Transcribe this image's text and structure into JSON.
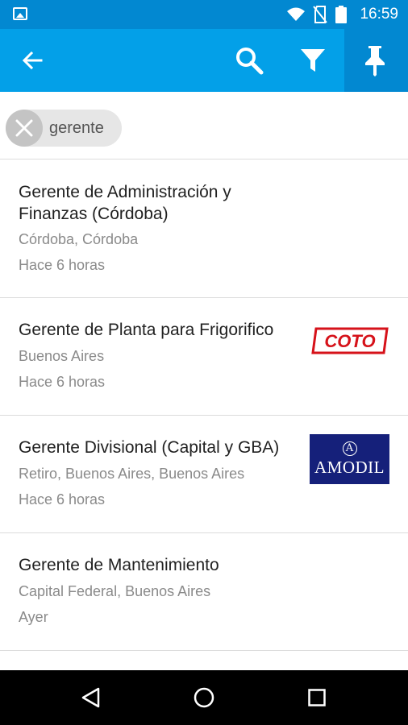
{
  "status_bar": {
    "time": "16:59",
    "icons": [
      "image-icon",
      "wifi-icon",
      "no-sim-icon",
      "battery-icon"
    ]
  },
  "app_bar": {
    "icons": [
      "back-arrow-icon",
      "search-icon",
      "filter-icon",
      "pin-icon"
    ],
    "colors": {
      "primary": "#03a0e8",
      "primary_dark": "#0288d1"
    }
  },
  "filter_chip": {
    "label": "gerente"
  },
  "jobs": [
    {
      "title": "Gerente de Administración y Finanzas (Córdoba)",
      "location": "Córdoba, Córdoba",
      "posted": "Hace 6 horas",
      "logo": ""
    },
    {
      "title": "Gerente de Planta para Frigorifico",
      "location": "Buenos Aires",
      "posted": "Hace 6 horas",
      "logo": "COTO"
    },
    {
      "title": "Gerente Divisional (Capital y GBA)",
      "location": "Retiro, Buenos Aires, Buenos Aires",
      "posted": "Hace 6 horas",
      "logo": "AMODIL"
    },
    {
      "title": "Gerente de Mantenimiento",
      "location": "Capital Federal, Buenos Aires",
      "posted": "Ayer",
      "logo": ""
    }
  ],
  "nav_bar": {
    "icons": [
      "back-triangle-icon",
      "home-circle-icon",
      "recents-square-icon"
    ]
  }
}
